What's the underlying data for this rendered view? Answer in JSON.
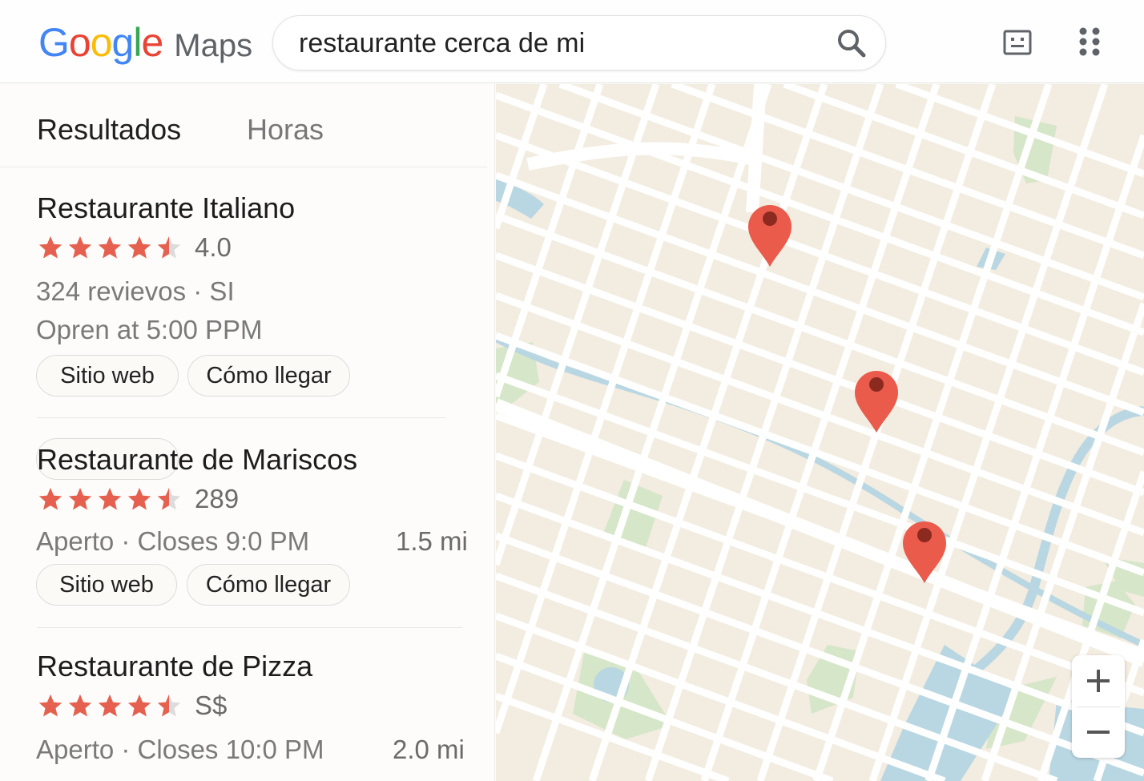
{
  "header": {
    "logo": {
      "letters": [
        "G",
        "o",
        "o",
        "g",
        "l",
        "e"
      ],
      "product": "Maps"
    },
    "search": {
      "value": "restaurante cerca de mi",
      "placeholder": ""
    },
    "icons": [
      "search-icon",
      "keyboard-icon",
      "apps-grid-icon"
    ]
  },
  "tabs": [
    {
      "label": "Resultados",
      "active": true
    },
    {
      "label": "Horas",
      "active": false
    }
  ],
  "results": [
    {
      "name": "Restaurante Italiano",
      "rating": 4.5,
      "rating_text": "4.0",
      "meta_line_1": "324 revievos · SI",
      "meta_line_2": "Opren at 5:00 PPM",
      "distance": "",
      "buttons": [
        "Sitio web",
        "Cómo llegar"
      ]
    },
    {
      "name": "Restaurante de Mariscos",
      "rating": 4.5,
      "rating_text": "289",
      "meta_line_1": "Aperto · Closes 9:0 PM",
      "meta_line_2": "",
      "distance": "1.5 mi",
      "buttons": [
        "Sitio web",
        "Cómo llegar"
      ]
    },
    {
      "name": "Restaurante de Pizza",
      "rating": 4.5,
      "rating_text": "S$",
      "meta_line_1": "Aperto · Closes 10:0 PM",
      "meta_line_2": "",
      "distance": "2.0 mi",
      "buttons": []
    }
  ],
  "map": {
    "pin_count": 3,
    "zoom_in_label": "+",
    "zoom_out_label": "−"
  },
  "colors": {
    "accent_red": "#ea5b4c",
    "star_red": "#e5604f",
    "map_background": "#f3ece0",
    "road": "#ffffff",
    "park": "#d6e6c8",
    "water": "#b9d7e2"
  }
}
